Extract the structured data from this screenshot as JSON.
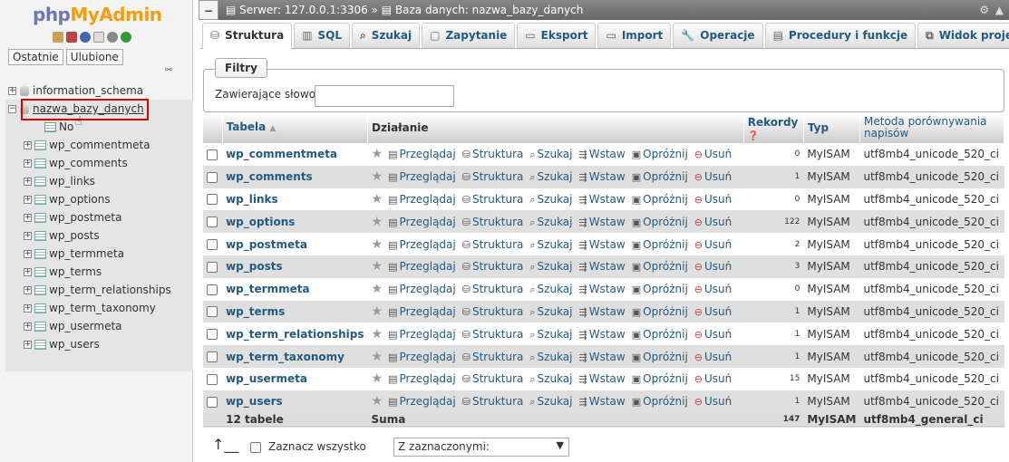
{
  "nav": {
    "logo_php": "php",
    "logo_my": "MyAdmin",
    "btn_recent": "Ostatnie",
    "btn_favorites": "Ulubione",
    "tree": [
      {
        "name": "information_schema",
        "type": "db"
      },
      {
        "name": "nazwa_bazy_danych",
        "type": "db",
        "selected": true
      },
      {
        "name": "No",
        "type": "new"
      },
      {
        "name": "wp_commentmeta",
        "type": "table"
      },
      {
        "name": "wp_comments",
        "type": "table"
      },
      {
        "name": "wp_links",
        "type": "table"
      },
      {
        "name": "wp_options",
        "type": "table"
      },
      {
        "name": "wp_postmeta",
        "type": "table"
      },
      {
        "name": "wp_posts",
        "type": "table"
      },
      {
        "name": "wp_termmeta",
        "type": "table"
      },
      {
        "name": "wp_terms",
        "type": "table"
      },
      {
        "name": "wp_term_relationships",
        "type": "table"
      },
      {
        "name": "wp_term_taxonomy",
        "type": "table"
      },
      {
        "name": "wp_usermeta",
        "type": "table"
      },
      {
        "name": "wp_users",
        "type": "table"
      }
    ]
  },
  "breadcrumb": {
    "server": "Serwer: 127.0.0.1:3306",
    "sep": "»",
    "db": "Baza danych: nazwa_bazy_danych"
  },
  "tabs": [
    {
      "label": "Struktura",
      "icon": "structure-icon",
      "active": true
    },
    {
      "label": "SQL",
      "icon": "sql-icon"
    },
    {
      "label": "Szukaj",
      "icon": "search-icon"
    },
    {
      "label": "Zapytanie",
      "icon": "query-icon"
    },
    {
      "label": "Eksport",
      "icon": "export-icon"
    },
    {
      "label": "Import",
      "icon": "import-icon"
    },
    {
      "label": "Operacje",
      "icon": "wrench-icon"
    },
    {
      "label": "Procedury i funkcje",
      "icon": "routines-icon"
    },
    {
      "label": "Widok projektu",
      "icon": "designer-icon"
    }
  ],
  "filter": {
    "legend": "Filtry",
    "label": "Zawierające słowo:",
    "value": ""
  },
  "table": {
    "headers": {
      "name": "Tabela",
      "action": "Działanie",
      "rows": "Rekordy",
      "type": "Typ",
      "collation": "Metoda porównywania napisów"
    },
    "actions": {
      "browse": "Przeglądaj",
      "structure": "Struktura",
      "search": "Szukaj",
      "insert": "Wstaw",
      "empty": "Opróżnij",
      "drop": "Usuń"
    },
    "rows": [
      {
        "name": "wp_commentmeta",
        "rows": "0",
        "type": "MyISAM",
        "collation": "utf8mb4_unicode_520_ci"
      },
      {
        "name": "wp_comments",
        "rows": "1",
        "type": "MyISAM",
        "collation": "utf8mb4_unicode_520_ci"
      },
      {
        "name": "wp_links",
        "rows": "0",
        "type": "MyISAM",
        "collation": "utf8mb4_unicode_520_ci"
      },
      {
        "name": "wp_options",
        "rows": "122",
        "type": "MyISAM",
        "collation": "utf8mb4_unicode_520_ci"
      },
      {
        "name": "wp_postmeta",
        "rows": "2",
        "type": "MyISAM",
        "collation": "utf8mb4_unicode_520_ci"
      },
      {
        "name": "wp_posts",
        "rows": "3",
        "type": "MyISAM",
        "collation": "utf8mb4_unicode_520_ci"
      },
      {
        "name": "wp_termmeta",
        "rows": "0",
        "type": "MyISAM",
        "collation": "utf8mb4_unicode_520_ci"
      },
      {
        "name": "wp_terms",
        "rows": "1",
        "type": "MyISAM",
        "collation": "utf8mb4_unicode_520_ci"
      },
      {
        "name": "wp_term_relationships",
        "rows": "1",
        "type": "MyISAM",
        "collation": "utf8mb4_unicode_520_ci"
      },
      {
        "name": "wp_term_taxonomy",
        "rows": "1",
        "type": "MyISAM",
        "collation": "utf8mb4_unicode_520_ci"
      },
      {
        "name": "wp_usermeta",
        "rows": "15",
        "type": "MyISAM",
        "collation": "utf8mb4_unicode_520_ci"
      },
      {
        "name": "wp_users",
        "rows": "1",
        "type": "MyISAM",
        "collation": "utf8mb4_unicode_520_ci"
      }
    ],
    "footer": {
      "count": "12 tabele",
      "sum_label": "Suma",
      "rows": "147",
      "type": "MyISAM",
      "collation": "utf8mb4_general_ci"
    }
  },
  "bottom": {
    "select_all": "Zaznacz wszystko",
    "with_selected": "Z zaznaczonymi:"
  },
  "colors": {
    "link": "#235a81",
    "highlight_box": "#e00000"
  }
}
